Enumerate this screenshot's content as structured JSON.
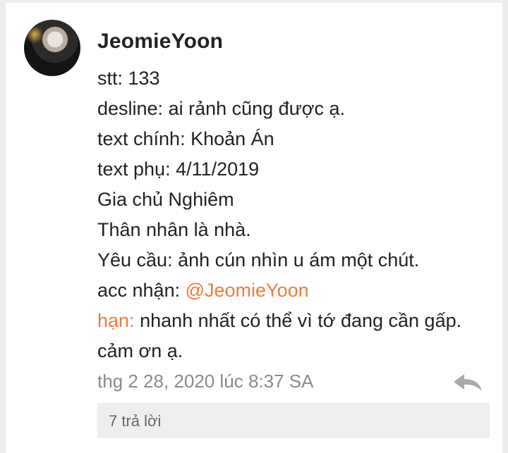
{
  "post": {
    "username": "JeomieYoon",
    "lines": {
      "l1": "stt: 133",
      "l2": "desline: ai rảnh cũng được ạ.",
      "l3": "text chính: Khoản Án",
      "l4": "text phụ: 4/11/2019",
      "l5": "Gia chủ Nghiêm",
      "l6": "Thân nhân là nhà.",
      "l7": "Yêu cầu: ảnh cún nhìn u ám một chút.",
      "l8_prefix": "acc nhận: ",
      "l8_mention": "@JeomieYoon",
      "l9_highlight": "hạn:",
      "l9_rest": " nhanh nhất có thể vì tớ đang cần gấp.",
      "l10": "cảm ơn ạ."
    },
    "timestamp": "thg 2 28, 2020 lúc 8:37 SA",
    "replies_label": "7 trả lời",
    "icons": {
      "reply": "reply-arrow-icon"
    },
    "colors": {
      "accent": "#f07a3c",
      "meta_text": "#8a8a8a"
    }
  }
}
